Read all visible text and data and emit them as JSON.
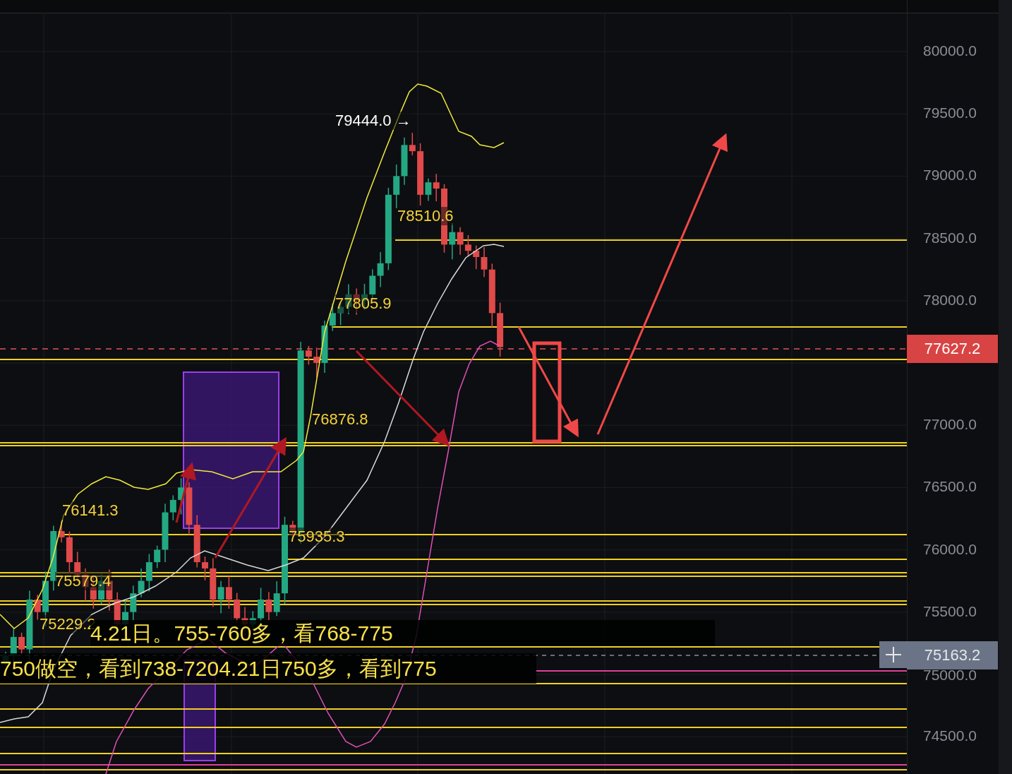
{
  "price_axis": {
    "labels": [
      "80000.0",
      "79500.0",
      "79000.0",
      "78500.0",
      "78000.0",
      "77000.0",
      "76500.0",
      "76000.0",
      "75500.0",
      "75000.0",
      "74500.0"
    ]
  },
  "current_price_tag": {
    "value": "77627.2"
  },
  "crosshair_tag": {
    "value": "75163.2"
  },
  "chart_labels": [
    {
      "text": "79444.0 →",
      "color": "#ffffff"
    },
    {
      "text": "78510.6",
      "color": "#f5d23a"
    },
    {
      "text": "77805.9",
      "color": "#f5d23a"
    },
    {
      "text": "76876.8",
      "color": "#f5d23a"
    },
    {
      "text": "76141.3",
      "color": "#f5d23a"
    },
    {
      "text": "75935.3",
      "color": "#f5d23a"
    },
    {
      "text": "75579.4",
      "color": "#f5d23a"
    },
    {
      "text": "75229.2",
      "color": "#f5d23a"
    }
  ],
  "notes": [
    {
      "text": "4.21日。755-760多，看768-775"
    },
    {
      "text": "750做空，看到738-720"
    },
    {
      "text": "4.21日750多，看到775"
    }
  ]
}
